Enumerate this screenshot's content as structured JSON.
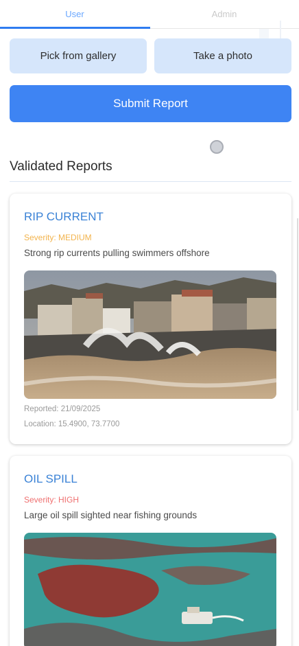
{
  "tabs": [
    {
      "label": "User",
      "active": true
    },
    {
      "label": "Admin",
      "active": false
    }
  ],
  "actions": {
    "gallery_label": "Pick from gallery",
    "photo_label": "Take a photo",
    "submit_label": "Submit Report"
  },
  "section": {
    "title": "Validated Reports"
  },
  "reports": [
    {
      "title": "RIP CURRENT",
      "severity": "Severity: MEDIUM",
      "description": "Strong rip currents pulling swimmers offshore",
      "image": "coastal-houses-storm-waves",
      "reported": "Reported: 21/09/2025",
      "location": "Location: 15.4900, 73.7700"
    },
    {
      "title": "OIL SPILL",
      "severity": "Severity: HIGH",
      "description": "Large oil spill sighted near fishing grounds",
      "image": "aerial-oil-spill-with-boat"
    }
  ],
  "colors": {
    "accent": "#2f7cf0",
    "submit": "#3e84f3",
    "light_button": "#d6e6fb",
    "title_blue": "#3a82d6",
    "severity_medium": "#f2b34c",
    "severity_high": "#ef6f6f"
  }
}
